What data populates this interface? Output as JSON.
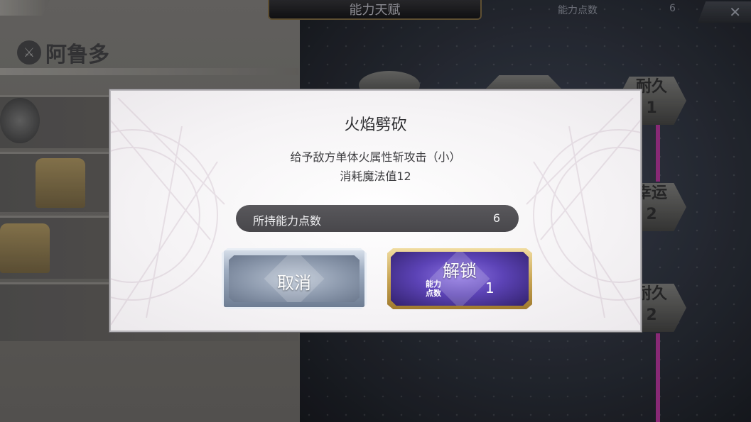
{
  "header": {
    "title": "能力天赋",
    "points_label": "能力点数",
    "points_value": "6",
    "close_icon": "close-icon"
  },
  "character": {
    "name": "阿鲁多",
    "emblem_icon": "sword-emblem-icon"
  },
  "skill_nodes": {
    "node_a": "耐久",
    "node_a_level": "1",
    "node_b": "幸运",
    "node_b_level": "2",
    "node_c": "耐久",
    "node_c_level": "2"
  },
  "modal": {
    "title": "火焰劈砍",
    "description": "给予敌方单体火属性斩攻击（小）",
    "cost_text": "消耗魔法值12",
    "owned_points_label": "所持能力点数",
    "owned_points_value": "6",
    "cancel_label": "取消",
    "unlock_label": "解锁",
    "unlock_cost_label": "能力\n点数",
    "unlock_cost_value": "1"
  },
  "colors": {
    "unlock_button": "#5c43b6",
    "unlock_border": "#c9a655",
    "cancel_button": "#8895a9",
    "points_bar": "#505053"
  }
}
